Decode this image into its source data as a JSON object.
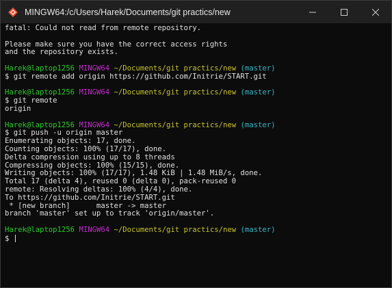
{
  "window": {
    "title": "MINGW64:/c/Users/Harek/Documents/git practics/new",
    "icon": "git-bash-diamond-icon",
    "accent_colors": {
      "user": "#2fc92f",
      "host": "#c02fc8",
      "path": "#c8c230",
      "branch": "#35b6c6",
      "text": "#e0e0e0",
      "background": "#0c0c0c"
    }
  },
  "controls": {
    "minimize": "minimize-icon",
    "maximize": "maximize-icon",
    "close": "close-icon"
  },
  "prompt": {
    "user": "Harek@laptop1256",
    "host": "MINGW64",
    "path": "~/Documents/git practics/new",
    "branch": "(master)"
  },
  "lines": [
    {
      "kind": "out",
      "text": "fatal: Could not read from remote repository."
    },
    {
      "kind": "out",
      "text": ""
    },
    {
      "kind": "out",
      "text": "Please make sure you have the correct access rights"
    },
    {
      "kind": "out",
      "text": "and the repository exists."
    },
    {
      "kind": "out",
      "text": ""
    },
    {
      "kind": "prompt"
    },
    {
      "kind": "cmd",
      "text": "$ git remote add origin https://github.com/Initrie/START.git"
    },
    {
      "kind": "out",
      "text": ""
    },
    {
      "kind": "prompt"
    },
    {
      "kind": "cmd",
      "text": "$ git remote"
    },
    {
      "kind": "out",
      "text": "origin"
    },
    {
      "kind": "out",
      "text": ""
    },
    {
      "kind": "prompt"
    },
    {
      "kind": "cmd",
      "text": "$ git push -u origin master"
    },
    {
      "kind": "out",
      "text": "Enumerating objects: 17, done."
    },
    {
      "kind": "out",
      "text": "Counting objects: 100% (17/17), done."
    },
    {
      "kind": "out",
      "text": "Delta compression using up to 8 threads"
    },
    {
      "kind": "out",
      "text": "Compressing objects: 100% (15/15), done."
    },
    {
      "kind": "out",
      "text": "Writing objects: 100% (17/17), 1.48 KiB | 1.48 MiB/s, done."
    },
    {
      "kind": "out",
      "text": "Total 17 (delta 4), reused 0 (delta 0), pack-reused 0"
    },
    {
      "kind": "out",
      "text": "remote: Resolving deltas: 100% (4/4), done."
    },
    {
      "kind": "out",
      "text": "To https://github.com/Initrie/START.git"
    },
    {
      "kind": "out",
      "text": " * [new branch]      master -> master"
    },
    {
      "kind": "out",
      "text": "branch 'master' set up to track 'origin/master'."
    },
    {
      "kind": "out",
      "text": ""
    },
    {
      "kind": "prompt"
    },
    {
      "kind": "input",
      "text": "$ "
    }
  ]
}
